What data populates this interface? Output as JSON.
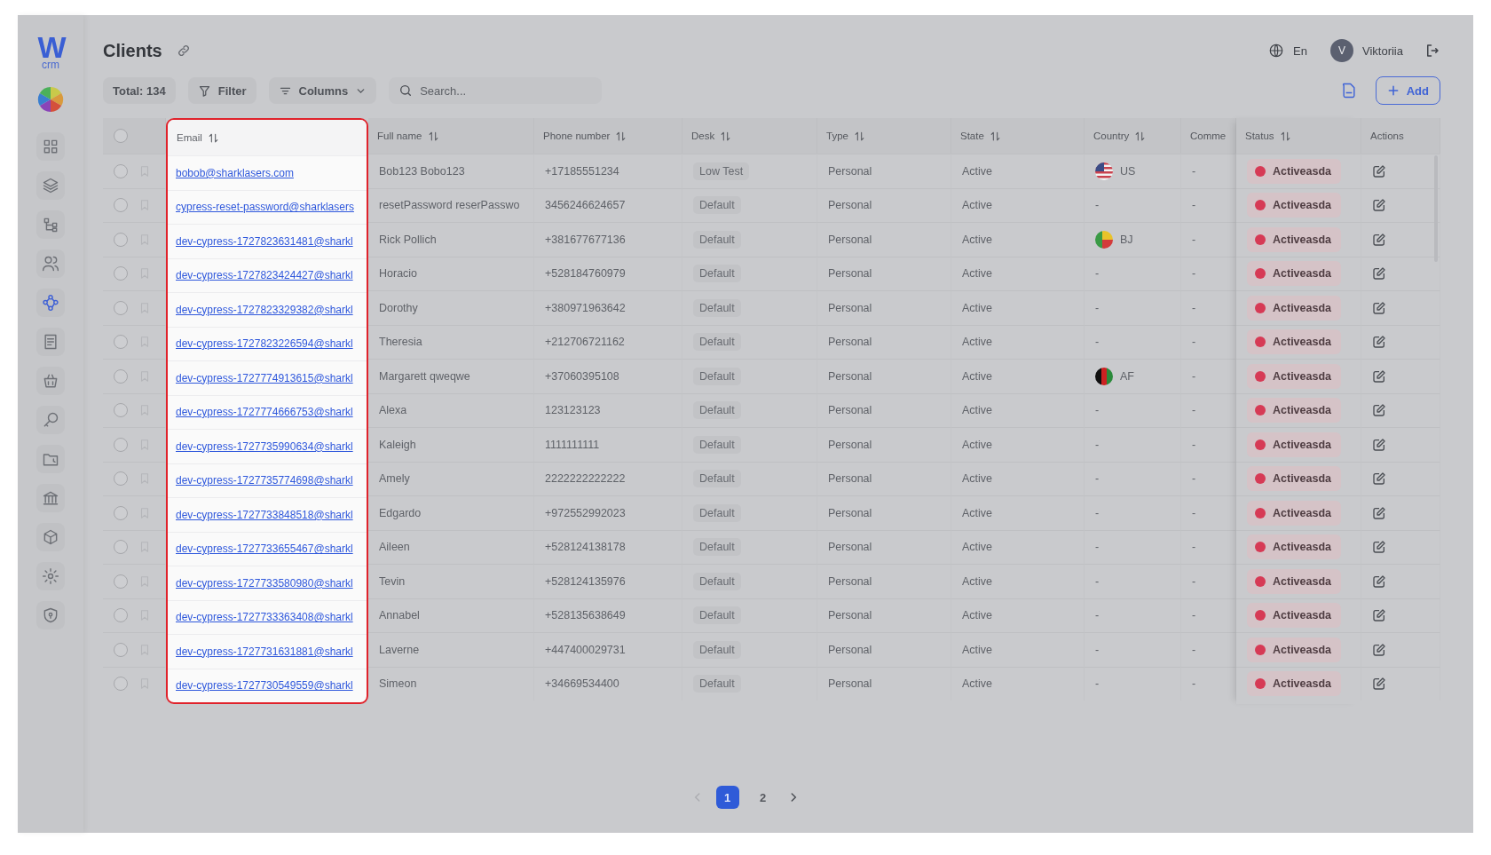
{
  "logo": {
    "mark": "W",
    "text": "crm"
  },
  "sidebar": {
    "items": [
      {
        "selected": false
      },
      {
        "selected": false
      },
      {
        "selected": false
      },
      {
        "selected": false
      },
      {
        "selected": true
      },
      {
        "selected": false
      },
      {
        "selected": false
      },
      {
        "selected": false
      },
      {
        "selected": false
      },
      {
        "selected": false
      },
      {
        "selected": false
      },
      {
        "selected": false
      },
      {
        "selected": false
      }
    ]
  },
  "header": {
    "title": "Clients",
    "language": "En",
    "user": {
      "initial": "V",
      "name": "Viktoriia"
    }
  },
  "toolbar": {
    "total": "Total: 134",
    "filter": "Filter",
    "columns": "Columns",
    "search_placeholder": "Search...",
    "add": "Add"
  },
  "table": {
    "all_checked": false,
    "columns": [
      {
        "label": "Email",
        "kind": "link",
        "sortable": true,
        "highlighted": true
      },
      {
        "label": "Full name",
        "kind": "text",
        "sortable": true,
        "highlighted": false
      },
      {
        "label": "Phone number",
        "kind": "text",
        "sortable": true,
        "highlighted": false
      },
      {
        "label": "Desk",
        "kind": "tag",
        "sortable": true,
        "highlighted": false
      },
      {
        "label": "Type",
        "kind": "text",
        "sortable": true,
        "highlighted": false
      },
      {
        "label": "State",
        "kind": "text",
        "sortable": true,
        "highlighted": false
      },
      {
        "label": "Country",
        "kind": "country",
        "sortable": true,
        "highlighted": false
      },
      {
        "label": "Comme",
        "kind": "text",
        "sortable": false,
        "highlighted": false
      },
      {
        "label": "Status",
        "kind": "status",
        "sortable": true,
        "highlighted": false
      },
      {
        "label": "Actions",
        "kind": "actions",
        "sortable": false,
        "highlighted": false
      }
    ],
    "rows": [
      {
        "checked": false,
        "cells": [
          "bobob@sharklasers.com",
          "Bob123 Bobo123",
          "+17185551234",
          "Low Test",
          "Personal",
          "Active",
          {
            "kind": "us",
            "code": "US"
          },
          "-",
          {
            "label": "Activeasda",
            "color": "#d63a55"
          }
        ]
      },
      {
        "checked": false,
        "cells": [
          "cypress-reset-password@sharklasers",
          "resetPassword reserPasswo",
          "3456246624657",
          "Default",
          "Personal",
          "Active",
          {
            "kind": "none",
            "code": "-"
          },
          "-",
          {
            "label": "Activeasda",
            "color": "#d63a55"
          }
        ]
      },
      {
        "checked": false,
        "cells": [
          "dev-cypress-1727823631481@sharkl",
          "Rick Pollich",
          "+381677677136",
          "Default",
          "Personal",
          "Active",
          {
            "kind": "bj",
            "code": "BJ"
          },
          "-",
          {
            "label": "Activeasda",
            "color": "#d63a55"
          }
        ]
      },
      {
        "checked": false,
        "cells": [
          "dev-cypress-1727823424427@sharkl",
          "Horacio",
          "+528184760979",
          "Default",
          "Personal",
          "Active",
          {
            "kind": "none",
            "code": "-"
          },
          "-",
          {
            "label": "Activeasda",
            "color": "#d63a55"
          }
        ]
      },
      {
        "checked": false,
        "cells": [
          "dev-cypress-1727823329382@sharkl",
          "Dorothy",
          "+380971963642",
          "Default",
          "Personal",
          "Active",
          {
            "kind": "none",
            "code": "-"
          },
          "-",
          {
            "label": "Activeasda",
            "color": "#d63a55"
          }
        ]
      },
      {
        "checked": false,
        "cells": [
          "dev-cypress-1727823226594@sharkl",
          "Theresia",
          "+212706721162",
          "Default",
          "Personal",
          "Active",
          {
            "kind": "none",
            "code": "-"
          },
          "-",
          {
            "label": "Activeasda",
            "color": "#d63a55"
          }
        ]
      },
      {
        "checked": false,
        "cells": [
          "dev-cypress-1727774913615@sharkl",
          "Margarett qweqwe",
          "+37060395108",
          "Default",
          "Personal",
          "Active",
          {
            "kind": "af",
            "code": "AF"
          },
          "-",
          {
            "label": "Activeasda",
            "color": "#d63a55"
          }
        ]
      },
      {
        "checked": false,
        "cells": [
          "dev-cypress-1727774666753@sharkl",
          "Alexa",
          "123123123",
          "Default",
          "Personal",
          "Active",
          {
            "kind": "none",
            "code": "-"
          },
          "-",
          {
            "label": "Activeasda",
            "color": "#d63a55"
          }
        ]
      },
      {
        "checked": false,
        "cells": [
          "dev-cypress-1727735990634@sharkl",
          "Kaleigh",
          "1111111111",
          "Default",
          "Personal",
          "Active",
          {
            "kind": "none",
            "code": "-"
          },
          "-",
          {
            "label": "Activeasda",
            "color": "#d63a55"
          }
        ]
      },
      {
        "checked": false,
        "cells": [
          "dev-cypress-1727735774698@sharkl",
          "Amely",
          "2222222222222",
          "Default",
          "Personal",
          "Active",
          {
            "kind": "none",
            "code": "-"
          },
          "-",
          {
            "label": "Activeasda",
            "color": "#d63a55"
          }
        ]
      },
      {
        "checked": false,
        "cells": [
          "dev-cypress-1727733848518@sharkl",
          "Edgardo",
          "+972552992023",
          "Default",
          "Personal",
          "Active",
          {
            "kind": "none",
            "code": "-"
          },
          "-",
          {
            "label": "Activeasda",
            "color": "#d63a55"
          }
        ]
      },
      {
        "checked": false,
        "cells": [
          "dev-cypress-1727733655467@sharkl",
          "Aileen",
          "+528124138178",
          "Default",
          "Personal",
          "Active",
          {
            "kind": "none",
            "code": "-"
          },
          "-",
          {
            "label": "Activeasda",
            "color": "#d63a55"
          }
        ]
      },
      {
        "checked": false,
        "cells": [
          "dev-cypress-1727733580980@sharkl",
          "Tevin",
          "+528124135976",
          "Default",
          "Personal",
          "Active",
          {
            "kind": "none",
            "code": "-"
          },
          "-",
          {
            "label": "Activeasda",
            "color": "#d63a55"
          }
        ]
      },
      {
        "checked": false,
        "cells": [
          "dev-cypress-1727733363408@sharkl",
          "Annabel",
          "+528135638649",
          "Default",
          "Personal",
          "Active",
          {
            "kind": "none",
            "code": "-"
          },
          "-",
          {
            "label": "Activeasda",
            "color": "#d63a55"
          }
        ]
      },
      {
        "checked": false,
        "cells": [
          "dev-cypress-1727731631881@sharkl",
          "Laverne",
          "+447400029731",
          "Default",
          "Personal",
          "Active",
          {
            "kind": "none",
            "code": "-"
          },
          "-",
          {
            "label": "Activeasda",
            "color": "#d63a55"
          }
        ]
      },
      {
        "checked": false,
        "cells": [
          "dev-cypress-1727730549559@sharkl",
          "Simeon",
          "+34669534400",
          "Default",
          "Personal",
          "Active",
          {
            "kind": "none",
            "code": "-"
          },
          "-",
          {
            "label": "Activeasda",
            "color": "#d63a55"
          }
        ]
      }
    ]
  },
  "pagination": {
    "prev_disabled": true,
    "next_disabled": false,
    "pages": [
      {
        "label": "1",
        "selected": true
      },
      {
        "label": "2",
        "selected": false
      }
    ]
  }
}
